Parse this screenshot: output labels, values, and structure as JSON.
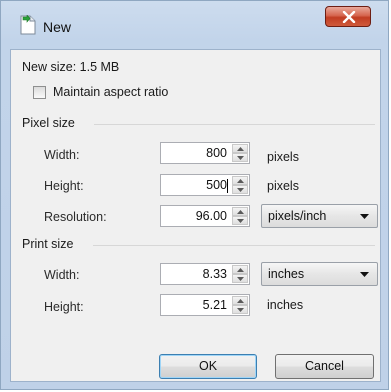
{
  "window": {
    "title": "New",
    "close_glyph": "X"
  },
  "info": {
    "new_size": "New size: 1.5 MB",
    "maintain_aspect_ratio": {
      "label": "Maintain aspect ratio",
      "checked": false
    }
  },
  "pixel_size": {
    "group_label": "Pixel size",
    "width": {
      "label": "Width:",
      "value": "800",
      "unit": "pixels"
    },
    "height": {
      "label": "Height:",
      "value": "500",
      "unit": "pixels"
    },
    "resolution": {
      "label": "Resolution:",
      "value": "96.00",
      "unit_selected": "pixels/inch"
    }
  },
  "print_size": {
    "group_label": "Print size",
    "width": {
      "label": "Width:",
      "value": "8.33",
      "unit_selected": "inches"
    },
    "height": {
      "label": "Height:",
      "value": "5.21",
      "unit": "inches"
    }
  },
  "buttons": {
    "ok": "OK",
    "cancel": "Cancel"
  },
  "icons": {
    "app": "new-image-icon",
    "close": "close-icon"
  },
  "colors": {
    "titlebar": "#c2d4ea",
    "close_button": "#c13d22",
    "client_bg": "#f0f0f0",
    "default_button_border": "#3c7fb1"
  }
}
